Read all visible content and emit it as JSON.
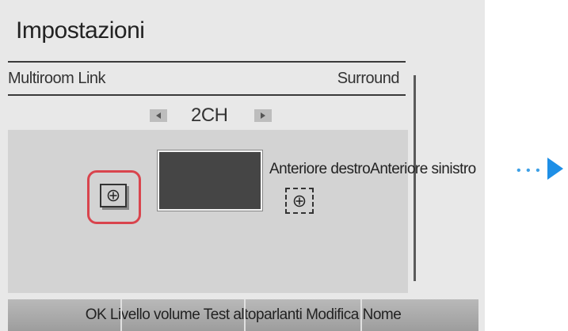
{
  "header": {
    "title": "Impostazioni"
  },
  "tabs": {
    "left": "Multiroom Link",
    "right": "Surround"
  },
  "mode_selector": {
    "value": "2CH",
    "prev_icon": "triangle-left-icon",
    "next_icon": "triangle-right-icon"
  },
  "speakers": {
    "label": "Anteriore destroAnteriore sinistro",
    "speaker_icon": "plus-circle-icon"
  },
  "bottom_bar": {
    "text": "OK Livello volume Test altoparlanti Modifica Nome"
  },
  "colors": {
    "selection": "#d9444d",
    "accent_arrow": "#1e8fe6",
    "panel_bg": "#e8e8e8",
    "content_bg": "#d3d3d3"
  }
}
